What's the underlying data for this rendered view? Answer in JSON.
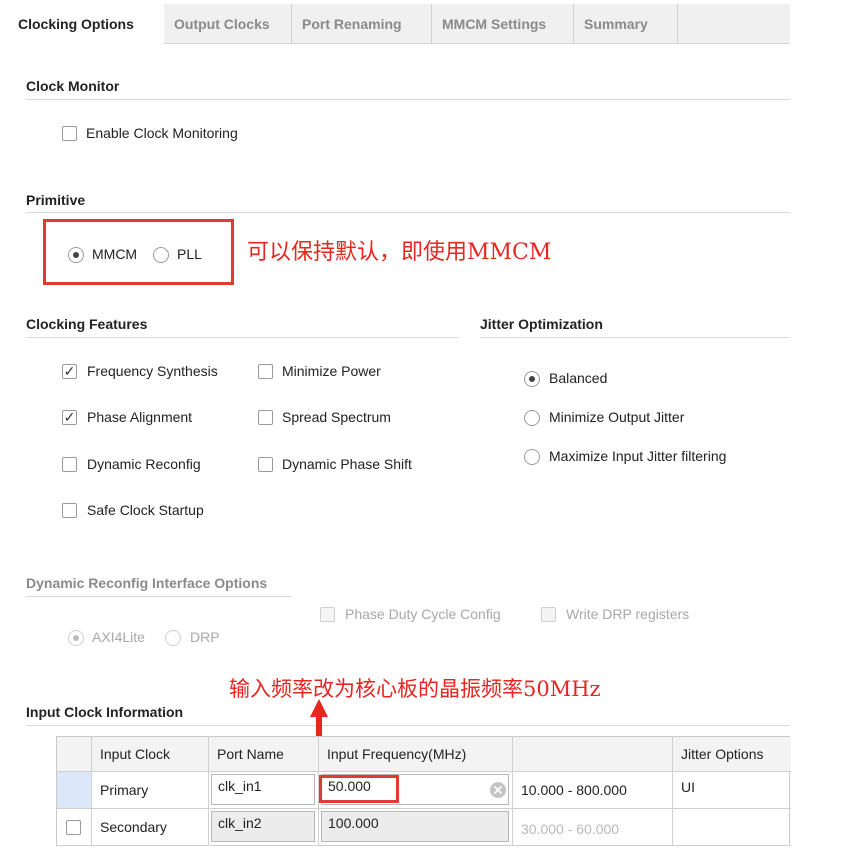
{
  "tabs": [
    {
      "label": "Clocking Options",
      "active": true
    },
    {
      "label": "Output Clocks",
      "active": false
    },
    {
      "label": "Port Renaming",
      "active": false
    },
    {
      "label": "MMCM Settings",
      "active": false
    },
    {
      "label": "Summary",
      "active": false
    }
  ],
  "clock_monitor": {
    "title": "Clock Monitor",
    "enable_label": "Enable Clock Monitoring",
    "enable_checked": false
  },
  "primitive": {
    "title": "Primitive",
    "options": [
      {
        "label": "MMCM",
        "selected": true
      },
      {
        "label": "PLL",
        "selected": false
      }
    ],
    "annotation": "可以保持默认，即使用MMCM"
  },
  "clocking_features": {
    "title": "Clocking Features",
    "items": [
      {
        "label": "Frequency Synthesis",
        "checked": true
      },
      {
        "label": "Minimize Power",
        "checked": false
      },
      {
        "label": "Phase Alignment",
        "checked": true
      },
      {
        "label": "Spread Spectrum",
        "checked": false
      },
      {
        "label": "Dynamic Reconfig",
        "checked": false
      },
      {
        "label": "Dynamic Phase Shift",
        "checked": false
      },
      {
        "label": "Safe Clock Startup",
        "checked": false
      }
    ]
  },
  "jitter_optimization": {
    "title": "Jitter Optimization",
    "options": [
      {
        "label": "Balanced",
        "selected": true
      },
      {
        "label": "Minimize Output Jitter",
        "selected": false
      },
      {
        "label": "Maximize Input Jitter filtering",
        "selected": false
      }
    ]
  },
  "dynamic_reconfig": {
    "title": "Dynamic Reconfig Interface Options",
    "checkboxes": [
      {
        "label": "Phase Duty Cycle Config",
        "checked": false
      },
      {
        "label": "Write DRP registers",
        "checked": false
      }
    ],
    "radios": [
      {
        "label": "AXI4Lite",
        "selected": true
      },
      {
        "label": "DRP",
        "selected": false
      }
    ]
  },
  "input_clock": {
    "title": "Input Clock Information",
    "annotation": "输入频率改为核心板的晶振频率50MHz",
    "headers": [
      "Input Clock",
      "Port Name",
      "Input Frequency(MHz)",
      "",
      "Jitter Options"
    ],
    "rows": [
      {
        "name": "Primary",
        "port": "clk_in1",
        "frequency": "50.000",
        "range": "10.000 - 800.000",
        "jitter": "UI"
      },
      {
        "name": "Secondary",
        "port": "clk_in2",
        "frequency": "100.000",
        "range": "30.000 - 60.000",
        "jitter": ""
      }
    ]
  },
  "colors": {
    "annotation_red": "#e8251f",
    "row_selected": "#dce8fa"
  }
}
